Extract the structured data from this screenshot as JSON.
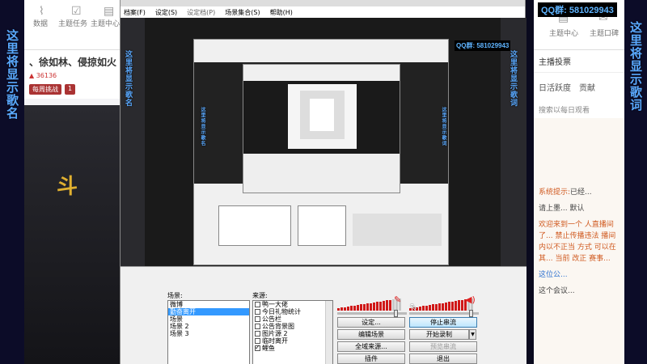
{
  "overlay": {
    "left_text": "这里将显示歌名",
    "right_text": "这里将显示歌词",
    "qq_label": "QQ群: 581029943"
  },
  "bg_app": {
    "tools": [
      "数据",
      "主题任务",
      "主题中心"
    ],
    "streamer_line": "、徐如林、侵掠如火",
    "fan_count": "▲ 36136",
    "tags": [
      "每周挑战",
      "1"
    ],
    "game_text": "斗"
  },
  "bg_right": {
    "tools": [
      "主题中心",
      "主题口碑"
    ],
    "follow": "主播投票",
    "tabs": [
      "日活跃度",
      "贡献"
    ],
    "search": "搜索以每日观看",
    "chat": [
      {
        "prefix": "系统提示:",
        "text": "已经..."
      },
      {
        "prefix": "",
        "text": "请上墨... 默认"
      },
      {
        "prefix": "",
        "text": "欢迎来到一个 人直播间 了... 禁止传播违法 播间内以不正当 方式 可以在其... 当前 改正 赛事..."
      },
      {
        "prefix": "",
        "text": "这位公..."
      },
      {
        "prefix": "",
        "text": "这个会议..."
      }
    ]
  },
  "obs": {
    "menu": [
      "档案(F)",
      "设定(S)",
      "设定档(P)",
      "场景集合(S)",
      "帮助(H)"
    ],
    "scenes_label": "场景:",
    "sources_label": "来源:",
    "scenes": [
      "微博",
      "勤奋离开",
      "场景",
      "场景 2",
      "场景 3"
    ],
    "selected_scene_index": 1,
    "sources": [
      {
        "name": "鸭一大佬",
        "checked": false
      },
      {
        "name": "今日礼物统计",
        "checked": false
      },
      {
        "name": "公告栏",
        "checked": false
      },
      {
        "name": "公告背景图",
        "checked": false
      },
      {
        "name": "图片源 2",
        "checked": false
      },
      {
        "name": "临时离开",
        "checked": false
      },
      {
        "name": "鲤鱼",
        "checked": true
      }
    ],
    "buttons": {
      "settings": "设定...",
      "stop_stream": "停止串流",
      "edit_scene": "编辑场景",
      "start_record": "开始录制",
      "global_sources": "全域来源...",
      "preview_stream": "预览串流",
      "plugins": "插件",
      "exit": "退出"
    },
    "mic_volume": 0.85,
    "desktop_volume": 0.9,
    "icons": {
      "mic": "microphone-icon",
      "speaker": "speaker-icon"
    }
  },
  "colors": {
    "meter": "#d01818",
    "overlay_text": "#5aa9ff",
    "selection": "#3399ff"
  }
}
